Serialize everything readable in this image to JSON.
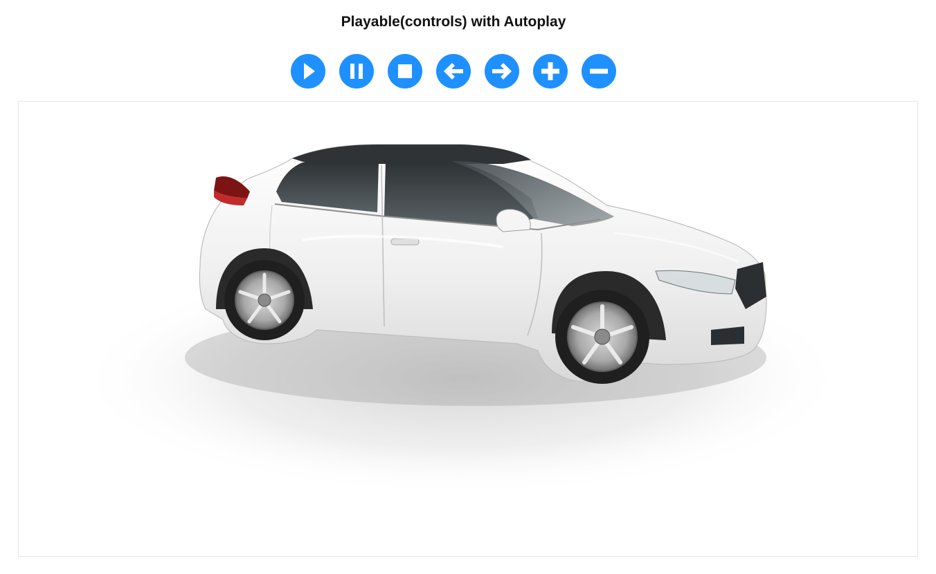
{
  "page": {
    "title": "Playable(controls) with Autoplay"
  },
  "controls": [
    {
      "name": "play-button",
      "icon": "play-icon"
    },
    {
      "name": "pause-button",
      "icon": "pause-icon"
    },
    {
      "name": "stop-button",
      "icon": "stop-icon"
    },
    {
      "name": "previous-button",
      "icon": "arrow-left-icon"
    },
    {
      "name": "next-button",
      "icon": "arrow-right-icon"
    },
    {
      "name": "zoom-in-button",
      "icon": "plus-icon"
    },
    {
      "name": "zoom-out-button",
      "icon": "minus-icon"
    }
  ],
  "viewer": {
    "subject": "white hatchback car 360 view"
  },
  "colors": {
    "control_fill": "#1e90ff",
    "control_icon": "#ffffff",
    "title_text": "#111111",
    "viewer_border": "#e6e6e6",
    "car_body": "#f2f2f2",
    "car_glass": "#3a3f41"
  }
}
